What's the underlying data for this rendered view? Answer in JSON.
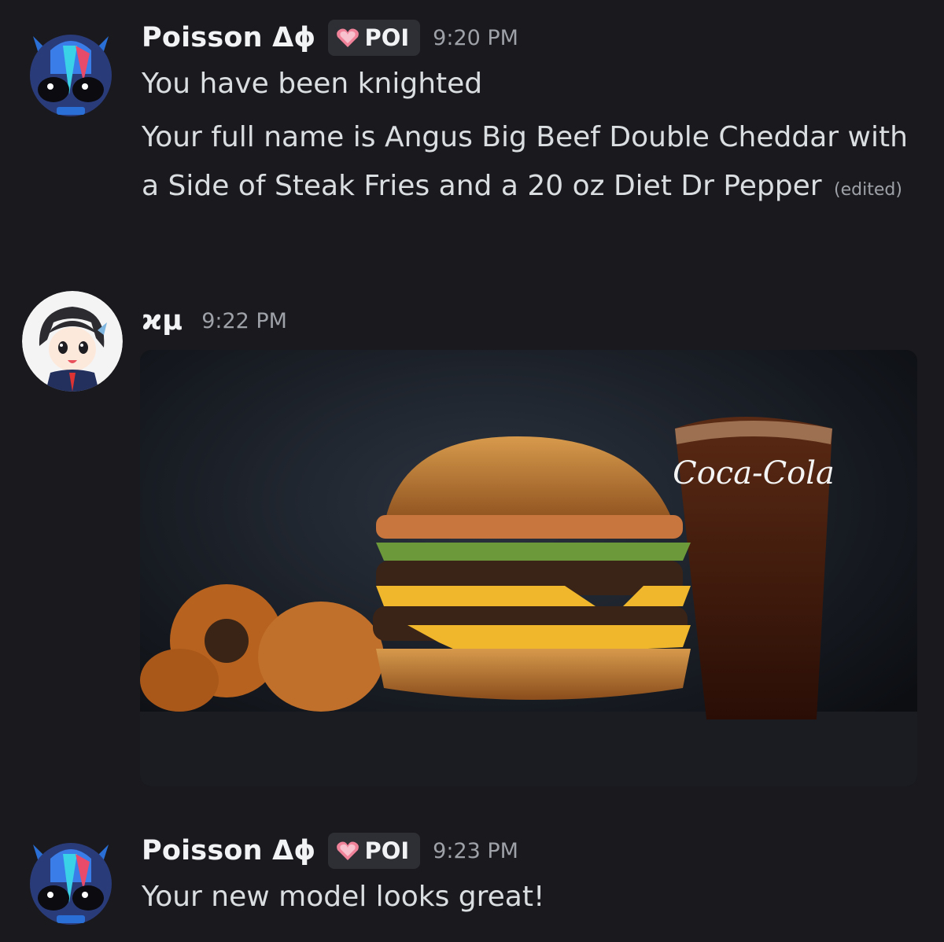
{
  "messages": [
    {
      "author": "Poisson Δϕ",
      "role_badge": "POI",
      "timestamp": "9:20 PM",
      "lines": [
        "You have been knighted",
        "Your full name is Angus Big Beef Double Cheddar with a Side of Steak Fries and a 20 oz Diet Dr Pepper"
      ],
      "edited_label": "(edited)"
    },
    {
      "author": "ϰμ",
      "timestamp": "9:22 PM",
      "attachment": {
        "type": "image",
        "cup_text": "Coca-Cola"
      }
    },
    {
      "author": "Poisson Δϕ",
      "role_badge": "POI",
      "timestamp": "9:23 PM",
      "lines": [
        "Your new model looks great!"
      ]
    }
  ],
  "colors": {
    "background": "#1a1a1e",
    "username": "#f2f3f5",
    "text": "#dbdee1",
    "timestamp": "#9ea1a8",
    "badge_bg": "#2e2f35",
    "badge_heart": "#f0839a"
  },
  "icons": [
    "heart-role-icon"
  ]
}
